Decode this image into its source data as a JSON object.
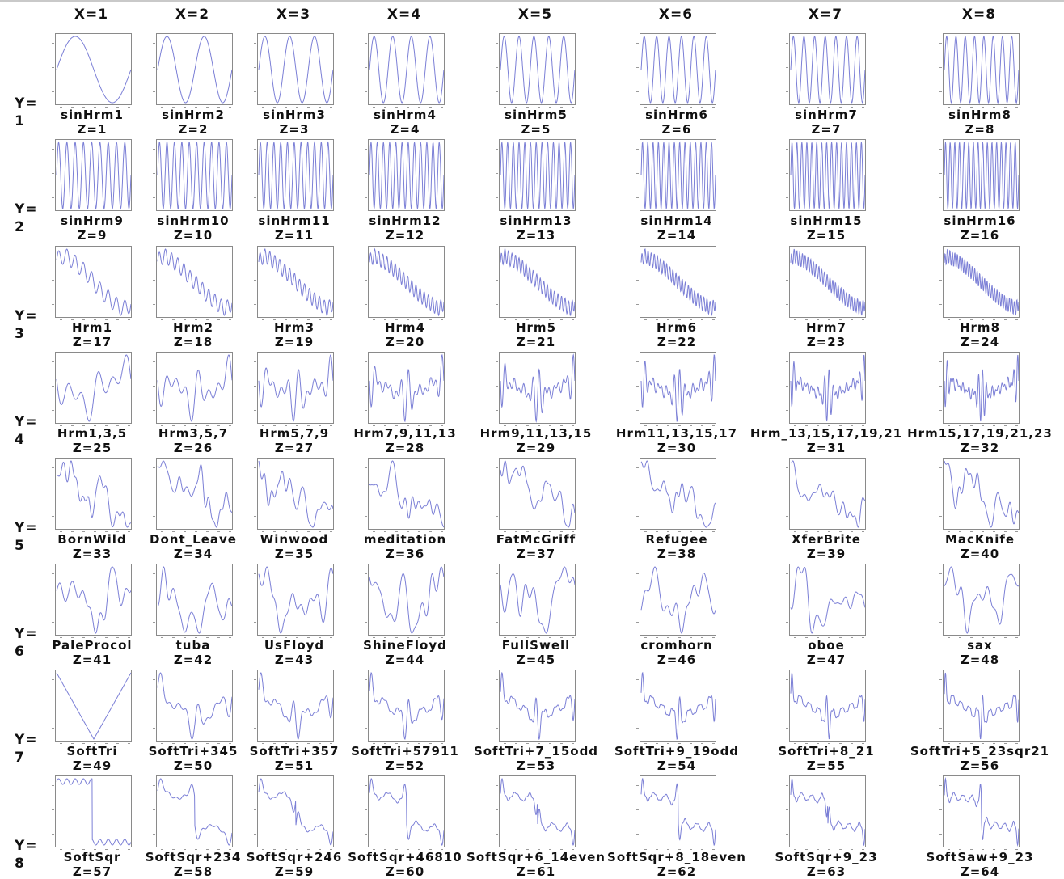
{
  "line_color": "#7b7fd6",
  "columns": [
    "X=1",
    "X=2",
    "X=3",
    "X=4",
    "X=5",
    "X=6",
    "X=7",
    "X=8"
  ],
  "rows": [
    {
      "label": "Y=",
      "num": "1"
    },
    {
      "label": "Y=",
      "num": "2"
    },
    {
      "label": "Y=",
      "num": "3"
    },
    {
      "label": "Y=",
      "num": "4"
    },
    {
      "label": "Y=",
      "num": "5"
    },
    {
      "label": "Y=",
      "num": "6"
    },
    {
      "label": "Y=",
      "num": "7"
    },
    {
      "label": "Y=",
      "num": "8"
    }
  ],
  "chart_data": {
    "type": "line",
    "grid": false,
    "panels": [
      {
        "name": "sinHrm1",
        "z": "Z=1"
      },
      {
        "name": "sinHrm2",
        "z": "Z=2"
      },
      {
        "name": "sinHrm3",
        "z": "Z=3"
      },
      {
        "name": "sinHrm4",
        "z": "Z=4"
      },
      {
        "name": "sinHrm5",
        "z": "Z=5"
      },
      {
        "name": "sinHrm6",
        "z": "Z=6"
      },
      {
        "name": "sinHrm7",
        "z": "Z=7"
      },
      {
        "name": "sinHrm8",
        "z": "Z=8"
      },
      {
        "name": "sinHrm9",
        "z": "Z=9"
      },
      {
        "name": "sinHrm10",
        "z": "Z=10"
      },
      {
        "name": "sinHrm11",
        "z": "Z=11"
      },
      {
        "name": "sinHrm12",
        "z": "Z=12"
      },
      {
        "name": "sinHrm13",
        "z": "Z=13"
      },
      {
        "name": "sinHrm14",
        "z": "Z=14"
      },
      {
        "name": "sinHrm15",
        "z": "Z=15"
      },
      {
        "name": "sinHrm16",
        "z": "Z=16"
      },
      {
        "name": "Hrm1",
        "z": "Z=17"
      },
      {
        "name": "Hrm2",
        "z": "Z=18"
      },
      {
        "name": "Hrm3",
        "z": "Z=19"
      },
      {
        "name": "Hrm4",
        "z": "Z=20"
      },
      {
        "name": "Hrm5",
        "z": "Z=21"
      },
      {
        "name": "Hrm6",
        "z": "Z=22"
      },
      {
        "name": "Hrm7",
        "z": "Z=23"
      },
      {
        "name": "Hrm8",
        "z": "Z=24"
      },
      {
        "name": "Hrm1,3,5",
        "z": "Z=25"
      },
      {
        "name": "Hrm3,5,7",
        "z": "Z=26"
      },
      {
        "name": "Hrm5,7,9",
        "z": "Z=27"
      },
      {
        "name": "Hrm7,9,11,13",
        "z": "Z=28"
      },
      {
        "name": "Hrm9,11,13,15",
        "z": "Z=29"
      },
      {
        "name": "Hrm11,13,15,17",
        "z": "Z=30"
      },
      {
        "name": "Hrm_13,15,17,19,21",
        "z": "Z=31"
      },
      {
        "name": "Hrm15,17,19,21,23",
        "z": "Z=32"
      },
      {
        "name": "BornWild",
        "z": "Z=33"
      },
      {
        "name": "Dont_Leave",
        "z": "Z=34"
      },
      {
        "name": "Winwood",
        "z": "Z=35"
      },
      {
        "name": "meditation",
        "z": "Z=36"
      },
      {
        "name": "FatMcGriff",
        "z": "Z=37"
      },
      {
        "name": "Refugee",
        "z": "Z=38"
      },
      {
        "name": "XferBrite",
        "z": "Z=39"
      },
      {
        "name": "MacKnife",
        "z": "Z=40"
      },
      {
        "name": "PaleProcol",
        "z": "Z=41"
      },
      {
        "name": "tuba",
        "z": "Z=42"
      },
      {
        "name": "UsFloyd",
        "z": "Z=43"
      },
      {
        "name": "ShineFloyd",
        "z": "Z=44"
      },
      {
        "name": "FullSwell",
        "z": "Z=45"
      },
      {
        "name": "cromhorn",
        "z": "Z=46"
      },
      {
        "name": "oboe",
        "z": "Z=47"
      },
      {
        "name": "sax",
        "z": "Z=48"
      },
      {
        "name": "SoftTri",
        "z": "Z=49"
      },
      {
        "name": "SoftTri+345",
        "z": "Z=50"
      },
      {
        "name": "SoftTri+357",
        "z": "Z=51"
      },
      {
        "name": "SoftTri+57911",
        "z": "Z=52"
      },
      {
        "name": "SoftTri+7_15odd",
        "z": "Z=53"
      },
      {
        "name": "SoftTri+9_19odd",
        "z": "Z=54"
      },
      {
        "name": "SoftTri+8_21",
        "z": "Z=55"
      },
      {
        "name": "SoftTri+5_23sqr21",
        "z": "Z=56"
      },
      {
        "name": "SoftSqr",
        "z": "Z=57"
      },
      {
        "name": "SoftSqr+234",
        "z": "Z=58"
      },
      {
        "name": "SoftSqr+246",
        "z": "Z=59"
      },
      {
        "name": "SoftSqr+46810",
        "z": "Z=60"
      },
      {
        "name": "SoftSqr+6_14even",
        "z": "Z=61"
      },
      {
        "name": "SoftSqr+8_18even",
        "z": "Z=62"
      },
      {
        "name": "SoftSqr+9_23",
        "z": "Z=63"
      },
      {
        "name": "SoftSaw+9_23",
        "z": "Z=64"
      }
    ]
  }
}
